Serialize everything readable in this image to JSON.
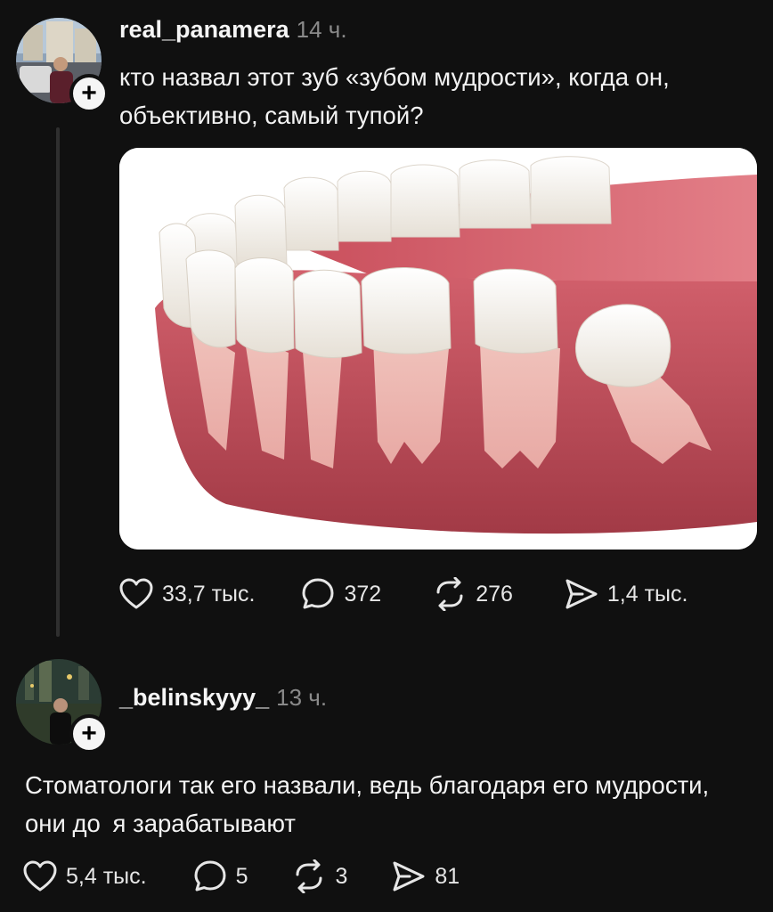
{
  "post": {
    "username": "real_panamera",
    "time": "14 ч.",
    "text": "кто назвал этот зуб «зубом мудрости», когда он, объективно, самый тупой?",
    "likes": "33,7 тыс.",
    "comments": "372",
    "reposts": "276",
    "shares": "1,4 тыс."
  },
  "reply": {
    "username": "_belinskyyy_",
    "time": "13 ч.",
    "text": "Стоматологи так его назвали, ведь благодаря его мудрости, они до   я зарабатывают",
    "likes": "5,4 тыс.",
    "comments": "5",
    "reposts": "3",
    "shares": "81"
  },
  "icons": {
    "like": "heart-icon",
    "comment": "speech-bubble-icon",
    "repost": "repost-arrows-icon",
    "share": "paper-plane-icon",
    "follow": "plus-icon"
  },
  "colors": {
    "background": "#101010",
    "text": "#f3f3f3",
    "muted": "#8a8a8a"
  }
}
